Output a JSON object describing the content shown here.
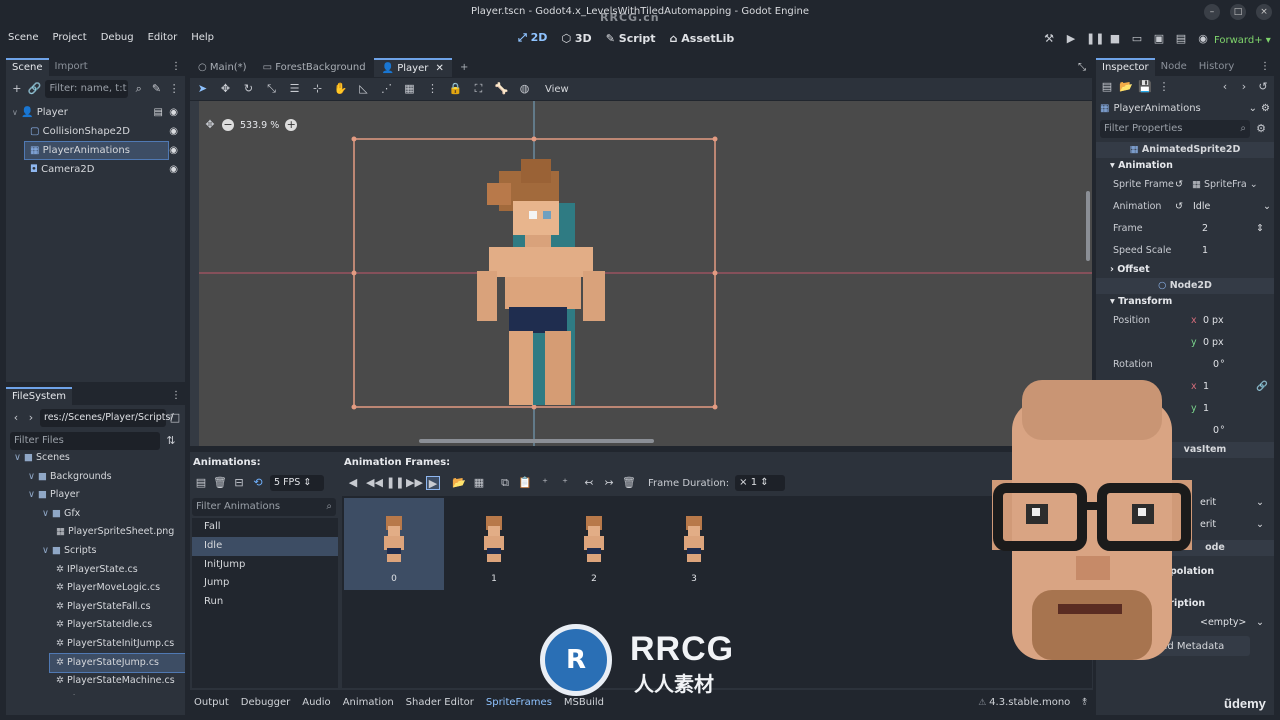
{
  "window": {
    "title": "Player.tscn - Godot4.x_LevelsWithTiledAutomapping - Godot Engine",
    "watermark_top": "RRCG.cn"
  },
  "menu": {
    "items": [
      "Scene",
      "Project",
      "Debug",
      "Editor",
      "Help"
    ]
  },
  "main_screens": [
    "2D",
    "3D",
    "Script",
    "AssetLib"
  ],
  "renderer": "Forward+",
  "scene_dock": {
    "tabs": [
      "Scene",
      "Import"
    ],
    "filter_placeholder": "Filter: name, t:t",
    "nodes": [
      {
        "name": "Player",
        "indent": 0
      },
      {
        "name": "CollisionShape2D",
        "indent": 1
      },
      {
        "name": "PlayerAnimations",
        "indent": 1,
        "selected": true
      },
      {
        "name": "Camera2D",
        "indent": 1
      }
    ]
  },
  "filesystem": {
    "tab": "FileSystem",
    "path": "res://Scenes/Player/Scripts/",
    "filter_placeholder": "Filter Files",
    "items": [
      {
        "name": "Scenes",
        "type": "folder",
        "indent": 0
      },
      {
        "name": "Backgrounds",
        "type": "folder",
        "indent": 1
      },
      {
        "name": "Player",
        "type": "folder",
        "indent": 1
      },
      {
        "name": "Gfx",
        "type": "folder",
        "indent": 2
      },
      {
        "name": "PlayerSpriteSheet.png",
        "type": "file",
        "indent": 3
      },
      {
        "name": "Scripts",
        "type": "folder",
        "indent": 2
      },
      {
        "name": "IPlayerState.cs",
        "type": "file",
        "indent": 3
      },
      {
        "name": "PlayerMoveLogic.cs",
        "type": "file",
        "indent": 3
      },
      {
        "name": "PlayerStateFall.cs",
        "type": "file",
        "indent": 3
      },
      {
        "name": "PlayerStateIdle.cs",
        "type": "file",
        "indent": 3
      },
      {
        "name": "PlayerStateInitJump.cs",
        "type": "file",
        "indent": 3
      },
      {
        "name": "PlayerStateJump.cs",
        "type": "file",
        "indent": 3,
        "selected": true
      },
      {
        "name": "PlayerStateMachine.cs",
        "type": "file",
        "indent": 3
      },
      {
        "name": "PlayerStateRun.cs",
        "type": "file",
        "indent": 3
      }
    ]
  },
  "editor_tabs": [
    "Main(*)",
    "ForestBackground",
    "Player"
  ],
  "toolbar": {
    "view_label": "View"
  },
  "viewport": {
    "zoom": "533.9 %"
  },
  "animation_panel": {
    "animations_label": "Animations:",
    "frames_label": "Animation Frames:",
    "fps": "5 FPS",
    "filter_placeholder": "Filter Animations",
    "animations": [
      "Fall",
      "Idle",
      "InitJump",
      "Jump",
      "Run"
    ],
    "selected_animation": "Idle",
    "frame_duration_label": "Frame Duration:",
    "frame_duration_value": "× 1",
    "frames": [
      "0",
      "1",
      "2",
      "3"
    ]
  },
  "bottom_tabs": [
    "Output",
    "Debugger",
    "Audio",
    "Animation",
    "Shader Editor",
    "SpriteFrames",
    "MSBuild"
  ],
  "version": "4.3.stable.mono",
  "inspector": {
    "tabs": [
      "Inspector",
      "Node",
      "History"
    ],
    "object": "PlayerAnimations",
    "filter_placeholder": "Filter Properties",
    "class_name": "AnimatedSprite2D",
    "animation_section": "Animation",
    "sprite_frames_label": "Sprite Frame",
    "sprite_frames_value": "SpriteFra",
    "animation_label": "Animation",
    "animation_value": "Idle",
    "frame_label": "Frame",
    "frame_value": "2",
    "speed_label": "Speed Scale",
    "speed_value": "1",
    "offset_section": "Offset",
    "node2d": "Node2D",
    "transform_section": "Transform",
    "position_label": "Position",
    "pos_x": "0",
    "pos_y": "0",
    "px_unit": "px",
    "rotation_label": "Rotation",
    "rotation_value": "0",
    "scale_x": "1",
    "scale_y": "1",
    "skew_value": "0",
    "canvas_item": "vasItem",
    "inherit1": "erit",
    "inherit2": "erit",
    "node_partial": "ode",
    "interp_partial": "polation",
    "ate_partial": "ate",
    "desc_partial": "scription",
    "empty_value": "<empty>",
    "add_metadata": "Add Metadata"
  },
  "watermark": {
    "brand": "RRCG",
    "sub": "人人素材",
    "udemy": "ũdemy"
  },
  "colors": {
    "accent": "#6fa3e8",
    "selection_outline": "#e39b82",
    "guide": "#c0566a"
  }
}
